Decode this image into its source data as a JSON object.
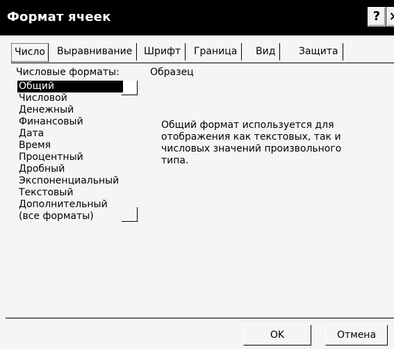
{
  "window": {
    "title": "Формат ячеек",
    "help": "?",
    "close": "×"
  },
  "tabs": [
    "Число",
    "Выравнивание",
    "Шрифт",
    "Граница",
    "Вид",
    "Защита"
  ],
  "formats_label": "Числовые форматы:",
  "sample_label": "Образец",
  "formats": [
    "Общий",
    "Числовой",
    "Денежный",
    "Финансовый",
    "Дата",
    "Время",
    "Процентный",
    "Дробный",
    "Экспоненциальный",
    "Текстовый",
    "Дополнительный",
    "(все форматы)"
  ],
  "selected_format": "Общий",
  "description": "Общий формат используется для отображения как текстовых, так и числовых значений произвольного типа.",
  "buttons": {
    "ok": "OK",
    "cancel": "Отмена"
  }
}
